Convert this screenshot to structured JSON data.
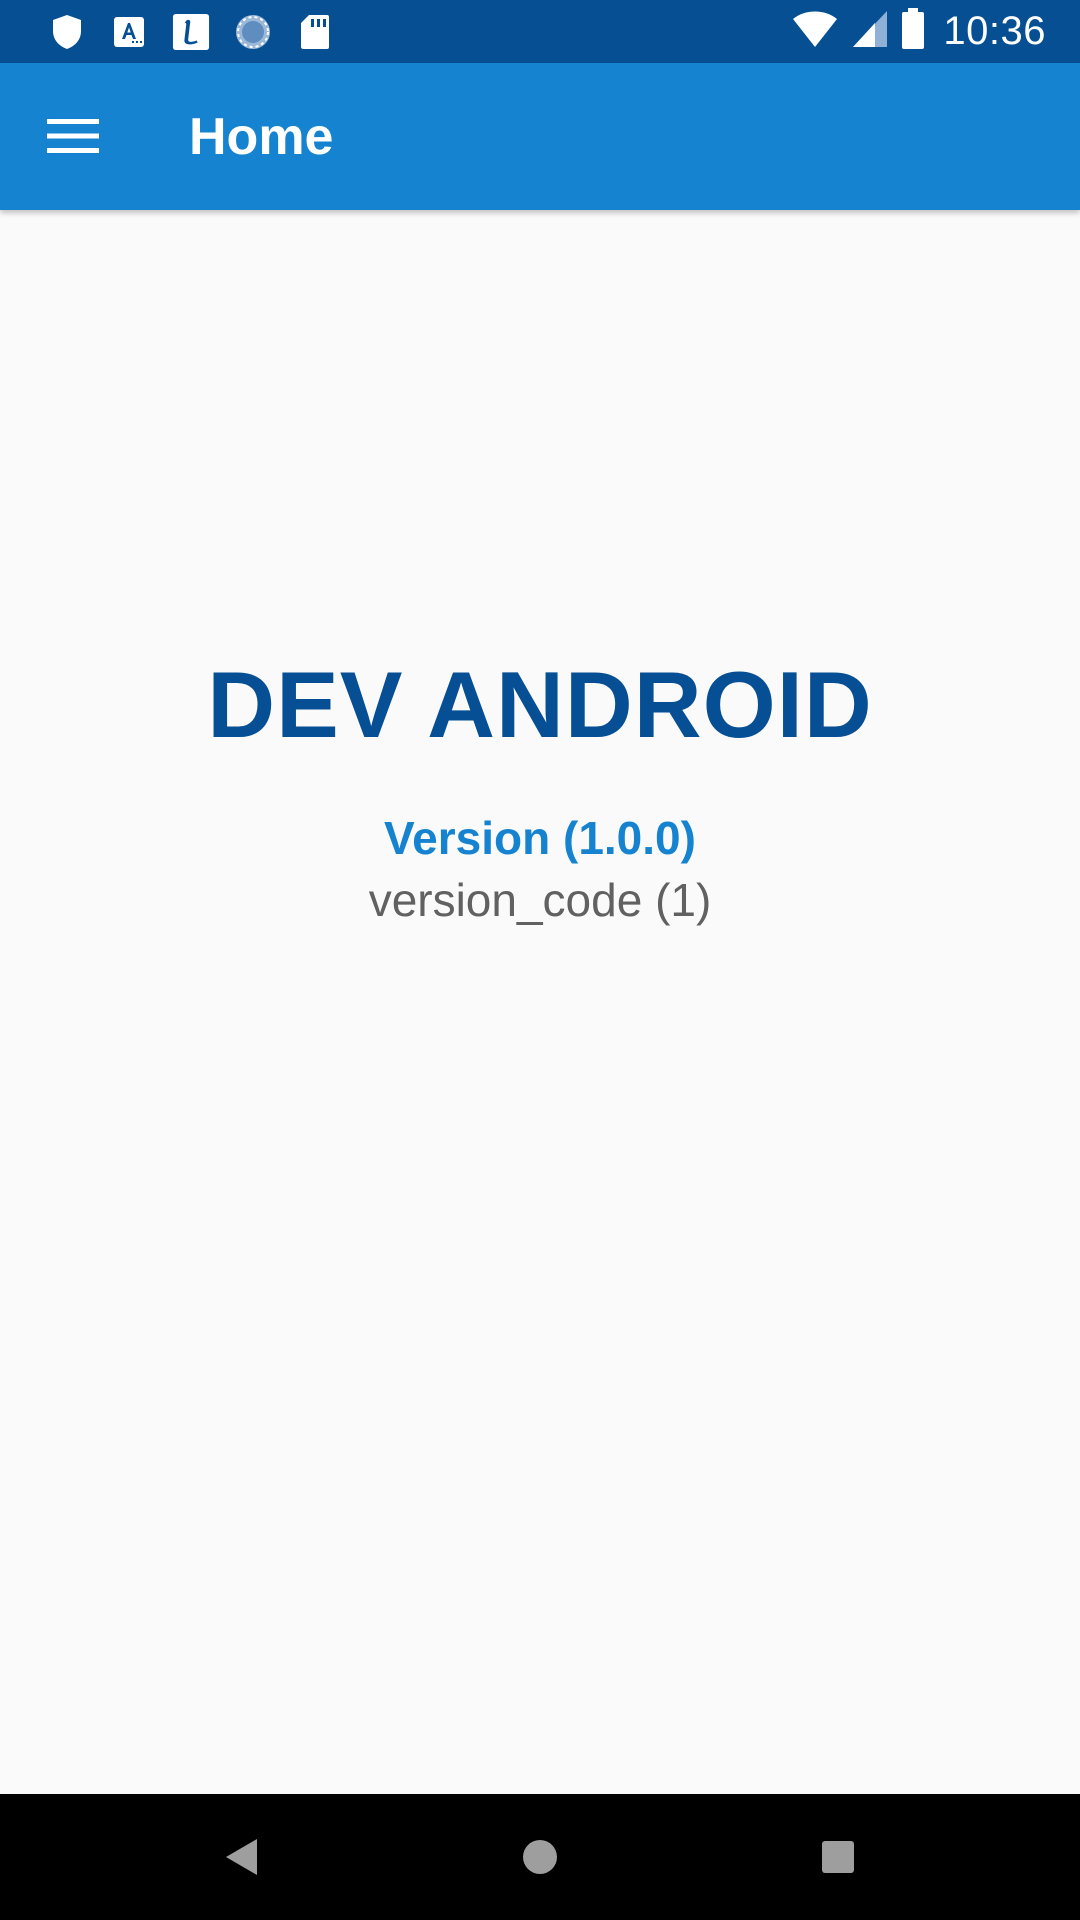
{
  "status_bar": {
    "time": "10:36",
    "left_icons": [
      "shield-icon",
      "text-a-icon",
      "l-app-icon",
      "sync-circle-icon",
      "sd-card-icon"
    ],
    "right_icons": [
      "wifi-icon",
      "cell-signal-icon",
      "battery-icon"
    ],
    "background_color": "#064f93"
  },
  "app_bar": {
    "title": "Home",
    "menu_icon": "menu-icon",
    "background_color": "#1583cf"
  },
  "main": {
    "title": "DEV ANDROID",
    "version_label": "Version (1.0.0)",
    "version_code_label": "version_code (1)",
    "title_color": "#074f94",
    "version_color": "#1583cf",
    "version_code_color": "#616161"
  },
  "nav_bar": {
    "icons": [
      "back-icon",
      "home-icon",
      "recents-icon"
    ]
  }
}
